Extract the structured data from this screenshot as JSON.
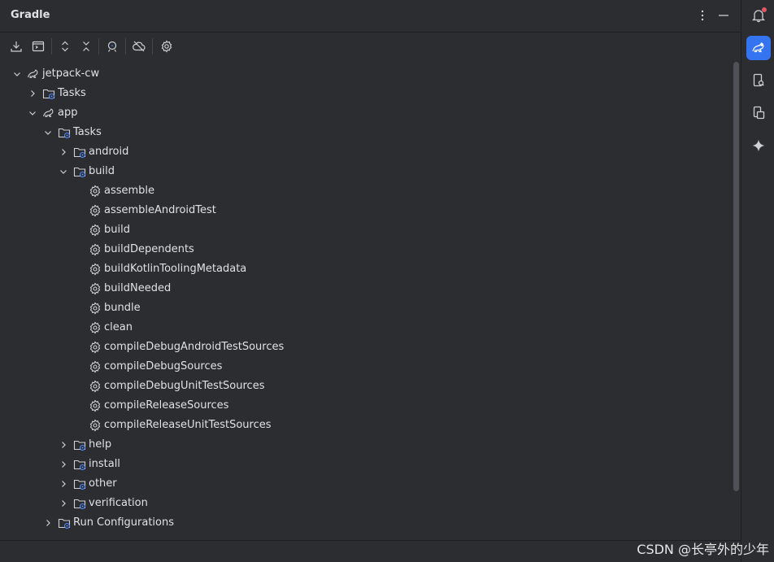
{
  "panel": {
    "title": "Gradle",
    "more_icon": "more-vertical-icon",
    "minimize_icon": "minimize-icon"
  },
  "toolbar": {
    "buttons": [
      {
        "icon": "download-sources-icon"
      },
      {
        "icon": "run-task-icon"
      },
      {
        "icon": "expand-all-icon"
      },
      {
        "icon": "collapse-all-icon"
      },
      {
        "icon": "analyze-dependencies-icon"
      },
      {
        "icon": "offline-mode-icon"
      },
      {
        "icon": "settings-icon"
      }
    ]
  },
  "tree": {
    "rows": [
      {
        "label": "jetpack-cw",
        "level": 0,
        "expanded": true,
        "kind": "project",
        "has_chevron": true
      },
      {
        "label": "Tasks",
        "level": 1,
        "expanded": false,
        "kind": "folder",
        "has_chevron": true
      },
      {
        "label": "app",
        "level": 1,
        "expanded": true,
        "kind": "project",
        "has_chevron": true
      },
      {
        "label": "Tasks",
        "level": 2,
        "expanded": true,
        "kind": "folder",
        "has_chevron": true
      },
      {
        "label": "android",
        "level": 3,
        "expanded": false,
        "kind": "folder",
        "has_chevron": true
      },
      {
        "label": "build",
        "level": 3,
        "expanded": true,
        "kind": "folder",
        "has_chevron": true
      },
      {
        "label": "assemble",
        "level": 4,
        "kind": "task",
        "has_chevron": false
      },
      {
        "label": "assembleAndroidTest",
        "level": 4,
        "kind": "task",
        "has_chevron": false
      },
      {
        "label": "build",
        "level": 4,
        "kind": "task",
        "has_chevron": false
      },
      {
        "label": "buildDependents",
        "level": 4,
        "kind": "task",
        "has_chevron": false
      },
      {
        "label": "buildKotlinToolingMetadata",
        "level": 4,
        "kind": "task",
        "has_chevron": false
      },
      {
        "label": "buildNeeded",
        "level": 4,
        "kind": "task",
        "has_chevron": false
      },
      {
        "label": "bundle",
        "level": 4,
        "kind": "task",
        "has_chevron": false
      },
      {
        "label": "clean",
        "level": 4,
        "kind": "task",
        "has_chevron": false
      },
      {
        "label": "compileDebugAndroidTestSources",
        "level": 4,
        "kind": "task",
        "has_chevron": false
      },
      {
        "label": "compileDebugSources",
        "level": 4,
        "kind": "task",
        "has_chevron": false
      },
      {
        "label": "compileDebugUnitTestSources",
        "level": 4,
        "kind": "task",
        "has_chevron": false
      },
      {
        "label": "compileReleaseSources",
        "level": 4,
        "kind": "task",
        "has_chevron": false
      },
      {
        "label": "compileReleaseUnitTestSources",
        "level": 4,
        "kind": "task",
        "has_chevron": false
      },
      {
        "label": "help",
        "level": 3,
        "expanded": false,
        "kind": "folder",
        "has_chevron": true
      },
      {
        "label": "install",
        "level": 3,
        "expanded": false,
        "kind": "folder",
        "has_chevron": true
      },
      {
        "label": "other",
        "level": 3,
        "expanded": false,
        "kind": "folder",
        "has_chevron": true
      },
      {
        "label": "verification",
        "level": 3,
        "expanded": false,
        "kind": "folder",
        "has_chevron": true
      },
      {
        "label": "Run Configurations",
        "level": 2,
        "expanded": false,
        "kind": "folder",
        "has_chevron": true
      }
    ]
  },
  "right_toolbar": {
    "buttons": [
      {
        "icon": "notifications-icon",
        "active": false,
        "badge": true
      },
      {
        "icon": "gradle-icon",
        "active": true
      },
      {
        "icon": "device-manager-icon",
        "active": false
      },
      {
        "icon": "running-devices-icon",
        "active": false
      },
      {
        "icon": "gemini-sparkle-icon",
        "active": false
      }
    ]
  },
  "watermark": "CSDN @长亭外的少年",
  "colors": {
    "background": "#2b2d30",
    "accent": "#3574f0",
    "text": "#dfe1e5",
    "icon": "#ced0d6"
  }
}
